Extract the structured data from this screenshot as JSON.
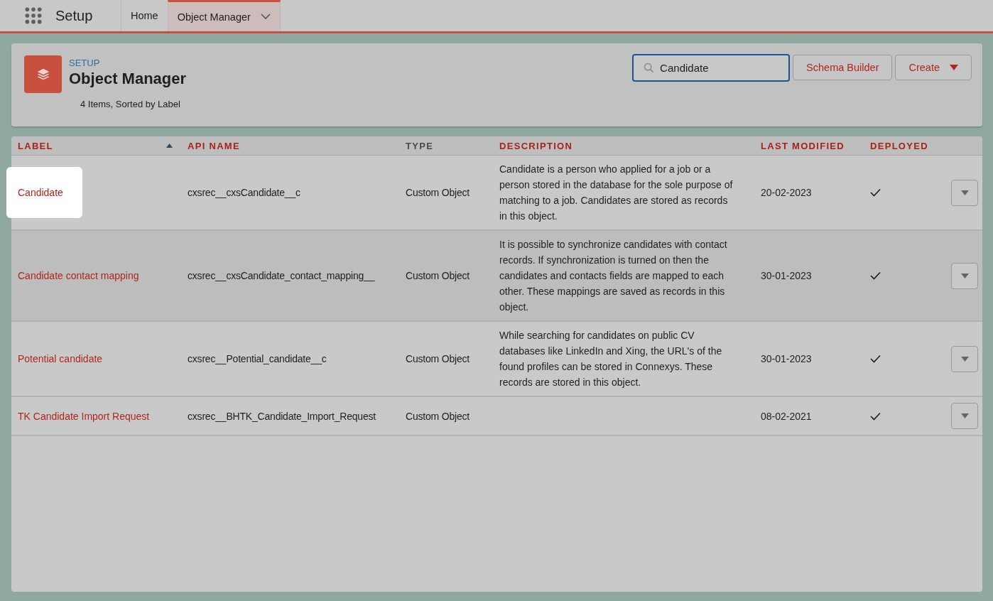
{
  "top_bar": {
    "app_name": "Setup",
    "tabs": [
      {
        "label": "Home",
        "selected": false,
        "has_menu": false
      },
      {
        "label": "Object Manager",
        "selected": true,
        "has_menu": true
      }
    ]
  },
  "header": {
    "eyebrow": "SETUP",
    "title": "Object Manager",
    "subtitle": "4 Items, Sorted by Label",
    "search": {
      "value": "Candidate"
    },
    "buttons": [
      {
        "label": "Schema Builder",
        "has_menu": false
      },
      {
        "label": "Create",
        "has_menu": true
      }
    ]
  },
  "table": {
    "columns": [
      {
        "label": "LABEL",
        "sortable": true,
        "sorted": true
      },
      {
        "label": "API NAME",
        "sortable": true,
        "sorted": false
      },
      {
        "label": "TYPE",
        "sortable": false,
        "sorted": false
      },
      {
        "label": "DESCRIPTION",
        "sortable": true,
        "sorted": false
      },
      {
        "label": "LAST MODIFIED",
        "sortable": true,
        "sorted": false
      },
      {
        "label": "DEPLOYED",
        "sortable": true,
        "sorted": false
      }
    ],
    "rows": [
      {
        "label": "Candidate",
        "api_name": "cxsrec__cxsCandidate__c",
        "type": "Custom Object",
        "description": "Candidate is a person who applied for a job or a person stored in the database for the sole purpose of matching to a job. Candidates are stored as records in this object.",
        "last_modified": "20-02-2023",
        "deployed": true,
        "highlighted": true,
        "hovered": false
      },
      {
        "label": "Candidate contact mapping",
        "api_name": "cxsrec__cxsCandidate_contact_mapping__",
        "type": "Custom Object",
        "description": "It is possible to synchronize candidates with contact records. If synchronization is turned on then the candidates and contacts fields are mapped to each other. These mappings are saved as records in this object.",
        "last_modified": "30-01-2023",
        "deployed": true,
        "highlighted": false,
        "hovered": true
      },
      {
        "label": "Potential candidate",
        "api_name": "cxsrec__Potential_candidate__c",
        "type": "Custom Object",
        "description": "While searching for candidates on public CV databases like LinkedIn and Xing, the URL's of the found profiles can be stored in Connexys. These records are stored in this object.",
        "last_modified": "30-01-2023",
        "deployed": true,
        "highlighted": false,
        "hovered": false
      },
      {
        "label": "TK Candidate Import Request",
        "api_name": "cxsrec__BHTK_Candidate_Import_Request",
        "type": "Custom Object",
        "description": "",
        "last_modified": "08-02-2021",
        "deployed": true,
        "highlighted": false,
        "hovered": false
      }
    ]
  }
}
